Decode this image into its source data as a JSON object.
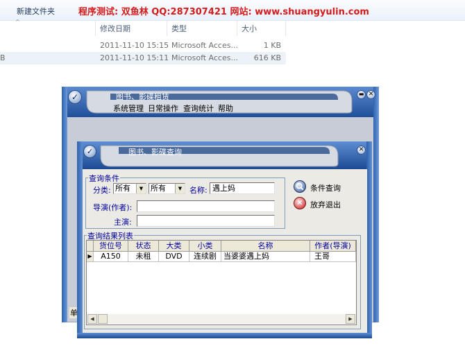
{
  "explorer": {
    "new_folder": "新建文件夹",
    "banner": "程序测试: 双鱼林 QQ:287307421  网站: www.shuangyulin.com",
    "columns": [
      "修改日期",
      "类型",
      "大小"
    ],
    "rows": [
      {
        "name": "",
        "date": "2011-11-10 15:15",
        "type": "Microsoft Acces...",
        "size": "1 KB"
      },
      {
        "name": "B",
        "date": "2011-11-10 15:11",
        "type": "Microsoft Acces...",
        "size": "616 KB"
      }
    ]
  },
  "main_window": {
    "title": "图书、影碟租赁",
    "menu": [
      "系统管理",
      "日常操作",
      "查询统计",
      "帮助"
    ],
    "status_fragment": "单"
  },
  "query_dialog": {
    "title": "图书、影碟查询",
    "criteria_group": "查询条件",
    "category_label": "分类:",
    "category_value_1": "所有",
    "category_value_2": "所有",
    "name_label": "名称:",
    "name_value": "遇上妈",
    "director_label": "导演(作者):",
    "director_value": "",
    "lead_label": "主演:",
    "lead_value": "",
    "search_button": "条件查询",
    "exit_button": "放弃退出",
    "results_group": "查询结果列表",
    "grid": {
      "headers": [
        "货位号",
        "状态",
        "大类",
        "小类",
        "名称",
        "作者(导演)"
      ],
      "rows": [
        [
          "A150",
          "未租",
          "DVD",
          "连续剧",
          "当婆婆遇上妈",
          "王哥"
        ]
      ]
    }
  },
  "colors": {
    "banner": "#d41c1c",
    "frame_blue": "#2f5fa6",
    "frame_light": "#c7ccd6",
    "label_blue": "#0000a0",
    "dialog_bg": "#eceae4"
  }
}
